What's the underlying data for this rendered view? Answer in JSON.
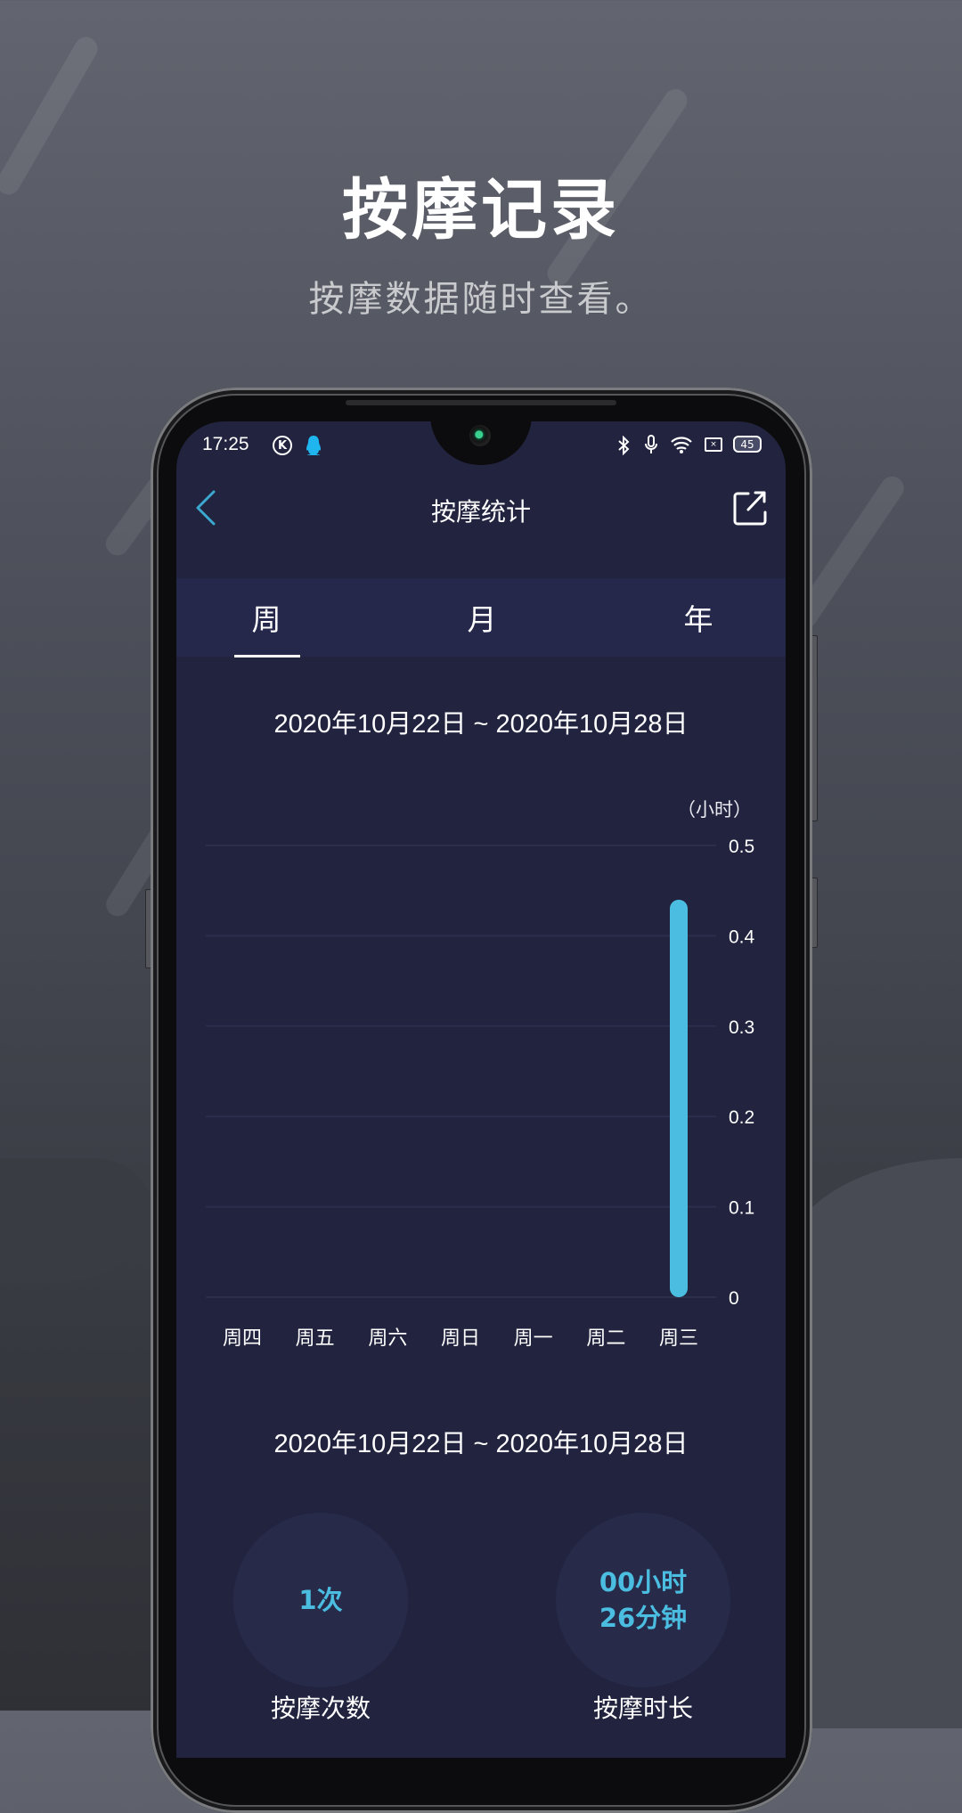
{
  "hero": {
    "title": "按摩记录",
    "subtitle": "按摩数据随时查看。"
  },
  "status_bar": {
    "time": "17:25",
    "left_icons": [
      "k-app-icon",
      "qq-penguin-icon"
    ],
    "right_icons": [
      "bluetooth-icon",
      "microphone-icon",
      "wifi-icon",
      "sim-card-icon",
      "battery-icon"
    ],
    "battery_level": "45"
  },
  "header": {
    "title": "按摩统计",
    "back_icon": "chevron-left-icon",
    "share_icon": "share-export-icon"
  },
  "tabs": [
    {
      "label": "周",
      "active": true
    },
    {
      "label": "月",
      "active": false
    },
    {
      "label": "年",
      "active": false
    }
  ],
  "chart_section": {
    "date_range": "2020年10月22日 ~ 2020年10月28日"
  },
  "summary_section": {
    "date_range": "2020年10月22日 ~ 2020年10月28日",
    "count_value": "1次",
    "duration_hours": "00小时",
    "duration_minutes": "26分钟",
    "count_label": "按摩次数",
    "duration_label": "按摩时长"
  },
  "colors": {
    "accent": "#4bbde0",
    "screen_bg": "#21233f",
    "tab_band_bg": "#25284a",
    "grid": "#2b2e4c"
  },
  "chart_data": {
    "type": "bar",
    "title": "",
    "xlabel": "",
    "ylabel": "（小时）",
    "categories": [
      "周四",
      "周五",
      "周六",
      "周日",
      "周一",
      "周二",
      "周三"
    ],
    "values": [
      0,
      0,
      0,
      0,
      0,
      0,
      0.44
    ],
    "ylim": [
      0,
      0.5
    ],
    "yticks": [
      0,
      0.1,
      0.2,
      0.3,
      0.4,
      0.5
    ],
    "ytick_labels": [
      "0",
      "0.1",
      "0.2",
      "0.3",
      "0.4",
      "0.5"
    ],
    "y_axis_side": "right",
    "grid": true,
    "legend": "none"
  }
}
